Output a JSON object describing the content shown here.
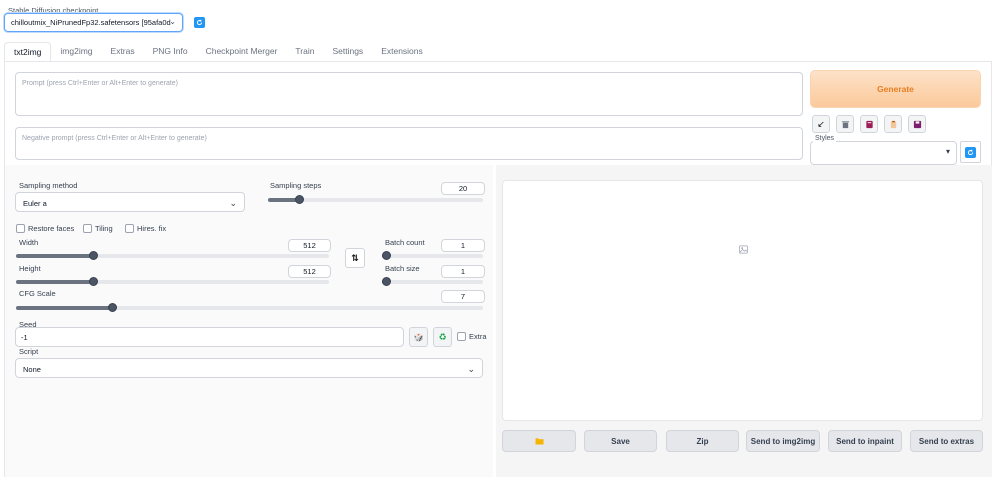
{
  "checkpoint": {
    "label": "Stable Diffusion checkpoint",
    "value": "chilloutmix_NiPrunedFp32.safetensors [95afa0d",
    "refresh_icon": "refresh-icon"
  },
  "tabs": [
    "txt2img",
    "img2img",
    "Extras",
    "PNG Info",
    "Checkpoint Merger",
    "Train",
    "Settings",
    "Extensions"
  ],
  "active_tab": "txt2img",
  "prompt": {
    "placeholder": "Prompt (press Ctrl+Enter or Alt+Enter to generate)",
    "negative_placeholder": "Negative prompt (press Ctrl+Enter or Alt+Enter to generate)"
  },
  "generate_label": "Generate",
  "tools": [
    "arrow-icon",
    "trash-icon",
    "book-icon",
    "clipboard-icon",
    "save-icon"
  ],
  "styles": {
    "label": "Styles",
    "value": ""
  },
  "sampling": {
    "method_label": "Sampling method",
    "method_value": "Euler a",
    "steps_label": "Sampling steps",
    "steps_value": "20",
    "steps_fraction": 0.13
  },
  "checkboxes": {
    "restore_faces": "Restore faces",
    "tiling": "Tiling",
    "hires_fix": "Hires. fix"
  },
  "width": {
    "label": "Width",
    "value": "512",
    "fraction": 0.24
  },
  "height": {
    "label": "Height",
    "value": "512",
    "fraction": 0.24
  },
  "batch_count": {
    "label": "Batch count",
    "value": "1",
    "fraction": 0.0
  },
  "batch_size": {
    "label": "Batch size",
    "value": "1",
    "fraction": 0.0
  },
  "cfg": {
    "label": "CFG Scale",
    "value": "7",
    "fraction": 0.2
  },
  "seed": {
    "label": "Seed",
    "value": "-1",
    "extra_label": "Extra"
  },
  "script": {
    "label": "Script",
    "value": "None"
  },
  "output_buttons": {
    "folder_icon": "folder-icon",
    "save": "Save",
    "zip": "Zip",
    "send_img2img": "Send to img2img",
    "send_inpaint": "Send to inpaint",
    "send_extras": "Send to extras"
  },
  "colors": {
    "accent": "#2196f3",
    "generate_text": "#e67e22",
    "generate_bg": "#fbc99a"
  }
}
